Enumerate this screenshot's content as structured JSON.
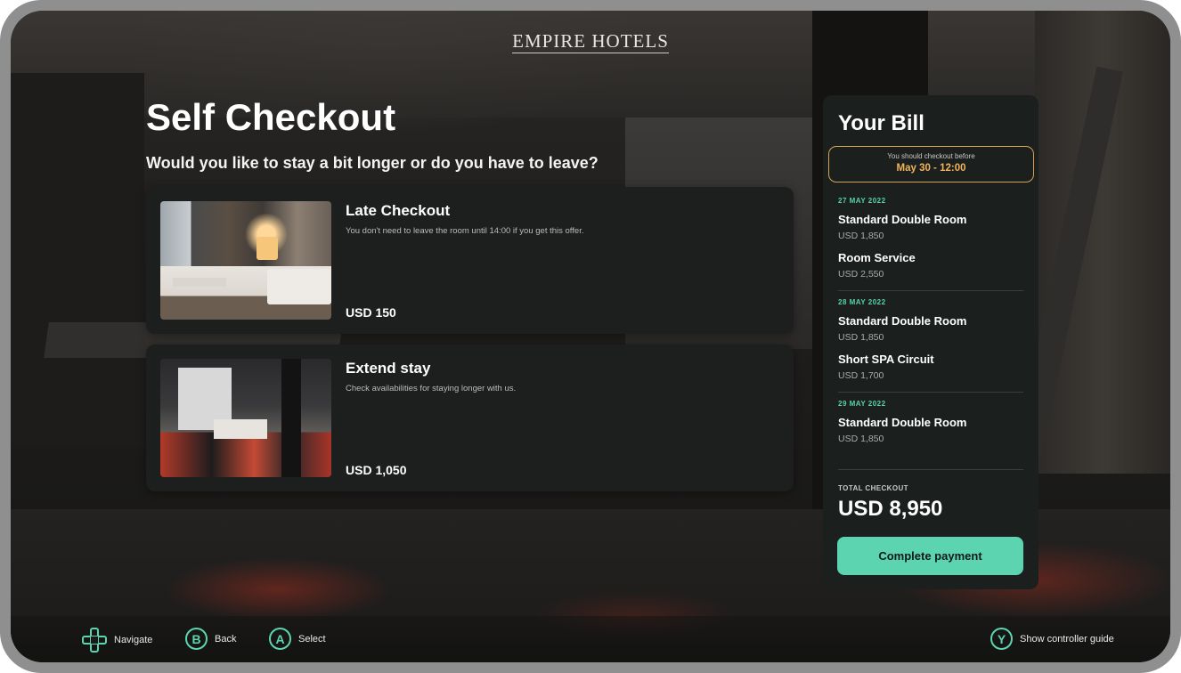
{
  "brand": {
    "name": "EMPIRE HOTELS"
  },
  "page": {
    "title": "Self Checkout",
    "subtitle": "Would you like to stay a bit longer or do you have to leave?"
  },
  "offers": [
    {
      "title": "Late Checkout",
      "description": "You don't need to leave the room until 14:00 if you get this offer.",
      "price": "USD 150",
      "image": "hotel-room-photo"
    },
    {
      "title": "Extend stay",
      "description": "Check availabilities for staying longer with us.",
      "price": "USD 1,050",
      "image": "hotel-suite-photo"
    }
  ],
  "bill": {
    "title": "Your Bill",
    "deadline_label": "You should checkout before",
    "deadline_value": "May 30 - 12:00",
    "days": [
      {
        "date": "27 MAY 2022",
        "items": [
          {
            "name": "Standard Double Room",
            "price": "USD 1,850"
          },
          {
            "name": "Room Service",
            "price": "USD 2,550"
          }
        ]
      },
      {
        "date": "28 MAY 2022",
        "items": [
          {
            "name": "Standard Double Room",
            "price": "USD 1,850"
          },
          {
            "name": "Short SPA Circuit",
            "price": "USD 1,700"
          }
        ]
      },
      {
        "date": "29 MAY 2022",
        "items": [
          {
            "name": "Standard Double Room",
            "price": "USD 1,850"
          }
        ]
      }
    ],
    "total_label": "TOTAL CHECKOUT",
    "total_value": "USD 8,950",
    "pay_button": "Complete payment"
  },
  "footer": {
    "navigate": "Navigate",
    "back_key": "B",
    "back": "Back",
    "select_key": "A",
    "select": "Select",
    "guide_key": "Y",
    "guide": "Show controller guide"
  },
  "colors": {
    "accent": "#5dd4b0",
    "deadline": "#f0b45a",
    "panel": "#1b1f1e"
  }
}
